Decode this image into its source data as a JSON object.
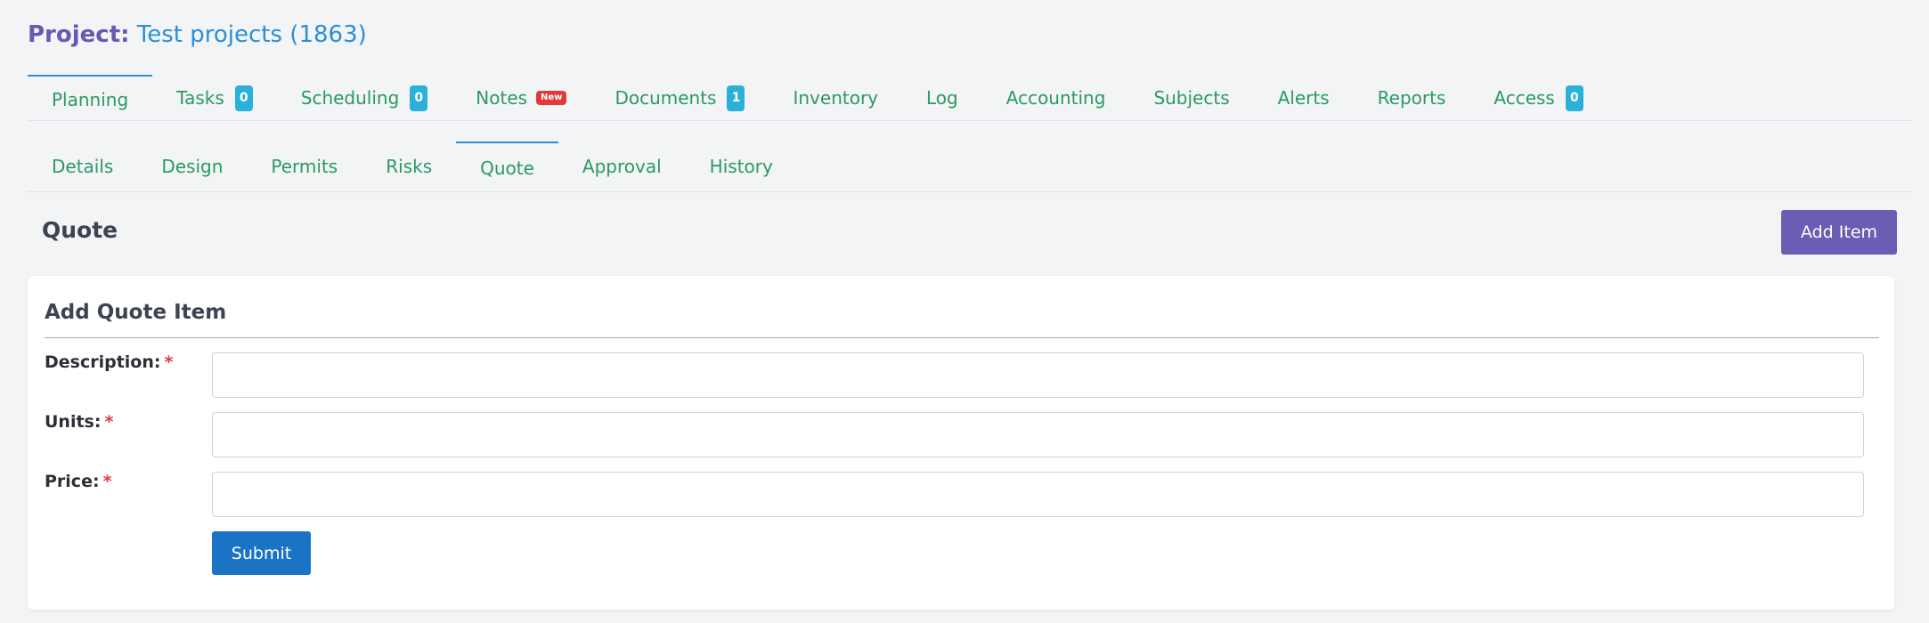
{
  "header": {
    "project_label": "Project:",
    "project_name": "Test projects (1863)"
  },
  "main_tabs": [
    {
      "label": "Planning",
      "active": true
    },
    {
      "label": "Tasks",
      "badge": "0"
    },
    {
      "label": "Scheduling",
      "badge": "0"
    },
    {
      "label": "Notes",
      "new_badge": "New"
    },
    {
      "label": "Documents",
      "badge": "1"
    },
    {
      "label": "Inventory"
    },
    {
      "label": "Log"
    },
    {
      "label": "Accounting"
    },
    {
      "label": "Subjects"
    },
    {
      "label": "Alerts"
    },
    {
      "label": "Reports"
    },
    {
      "label": "Access",
      "badge": "0"
    }
  ],
  "sub_tabs": [
    {
      "label": "Details"
    },
    {
      "label": "Design"
    },
    {
      "label": "Permits"
    },
    {
      "label": "Risks"
    },
    {
      "label": "Quote",
      "active": true
    },
    {
      "label": "Approval"
    },
    {
      "label": "History"
    }
  ],
  "section": {
    "title": "Quote",
    "add_item_label": "Add Item"
  },
  "form": {
    "title": "Add Quote Item",
    "required_mark": "*",
    "fields": [
      {
        "label": "Description:",
        "value": ""
      },
      {
        "label": "Units:",
        "value": ""
      },
      {
        "label": "Price:",
        "value": ""
      }
    ],
    "submit_label": "Submit"
  },
  "colors": {
    "accent_purple": "#6b5cb4",
    "tab_green": "#2a9a62",
    "active_blue": "#2c8fd6",
    "badge_cyan": "#2bb1d8",
    "required_red": "#e23a3a",
    "submit_blue": "#1a73c4"
  }
}
